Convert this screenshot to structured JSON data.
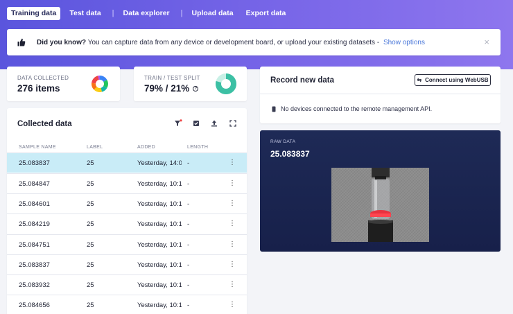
{
  "nav": {
    "tabs": [
      {
        "label": "Training data",
        "active": true
      },
      {
        "label": "Test data"
      },
      {
        "label": "Data explorer"
      },
      {
        "label": "Upload data"
      },
      {
        "label": "Export data"
      }
    ],
    "separator": "|"
  },
  "banner": {
    "icon": "thumbs-up-icon",
    "bold": "Did you know?",
    "text": " You can capture data from any device or development board, or upload your existing datasets - ",
    "link": "Show options",
    "close": "×"
  },
  "stats": {
    "collected": {
      "label": "DATA COLLECTED",
      "value": "276 items"
    },
    "split": {
      "label": "TRAIN / TEST SPLIT",
      "value": "79% / 21%",
      "train_percent": 79,
      "help": "?"
    }
  },
  "collected": {
    "title": "Collected data",
    "columns": [
      "SAMPLE NAME",
      "LABEL",
      "ADDED",
      "LENGTH"
    ],
    "rows": [
      {
        "name": "25.083837",
        "label": "25",
        "added": "Yesterday, 14:0…",
        "length": "-",
        "selected": true
      },
      {
        "name": "25.084847",
        "label": "25",
        "added": "Yesterday, 10:1…",
        "length": "-"
      },
      {
        "name": "25.084601",
        "label": "25",
        "added": "Yesterday, 10:1…",
        "length": "-"
      },
      {
        "name": "25.084219",
        "label": "25",
        "added": "Yesterday, 10:1…",
        "length": "-"
      },
      {
        "name": "25.084751",
        "label": "25",
        "added": "Yesterday, 10:1…",
        "length": "-"
      },
      {
        "name": "25.083837",
        "label": "25",
        "added": "Yesterday, 10:1…",
        "length": "-"
      },
      {
        "name": "25.083932",
        "label": "25",
        "added": "Yesterday, 10:1…",
        "length": "-"
      },
      {
        "name": "25.084656",
        "label": "25",
        "added": "Yesterday, 10:1…",
        "length": "-"
      }
    ],
    "row_menu": "⋮"
  },
  "record": {
    "title": "Record new data",
    "connect_label": "Connect using WebUSB",
    "status": "No devices connected to the remote management API."
  },
  "raw": {
    "label": "RAW DATA",
    "value": "25.083837"
  },
  "colors": {
    "accent": "#6a5ee3",
    "selected_row": "#c9ecf7",
    "link": "#4b78d9",
    "raw_bg": "#1a2450",
    "split_train": "#3cc0a4"
  }
}
